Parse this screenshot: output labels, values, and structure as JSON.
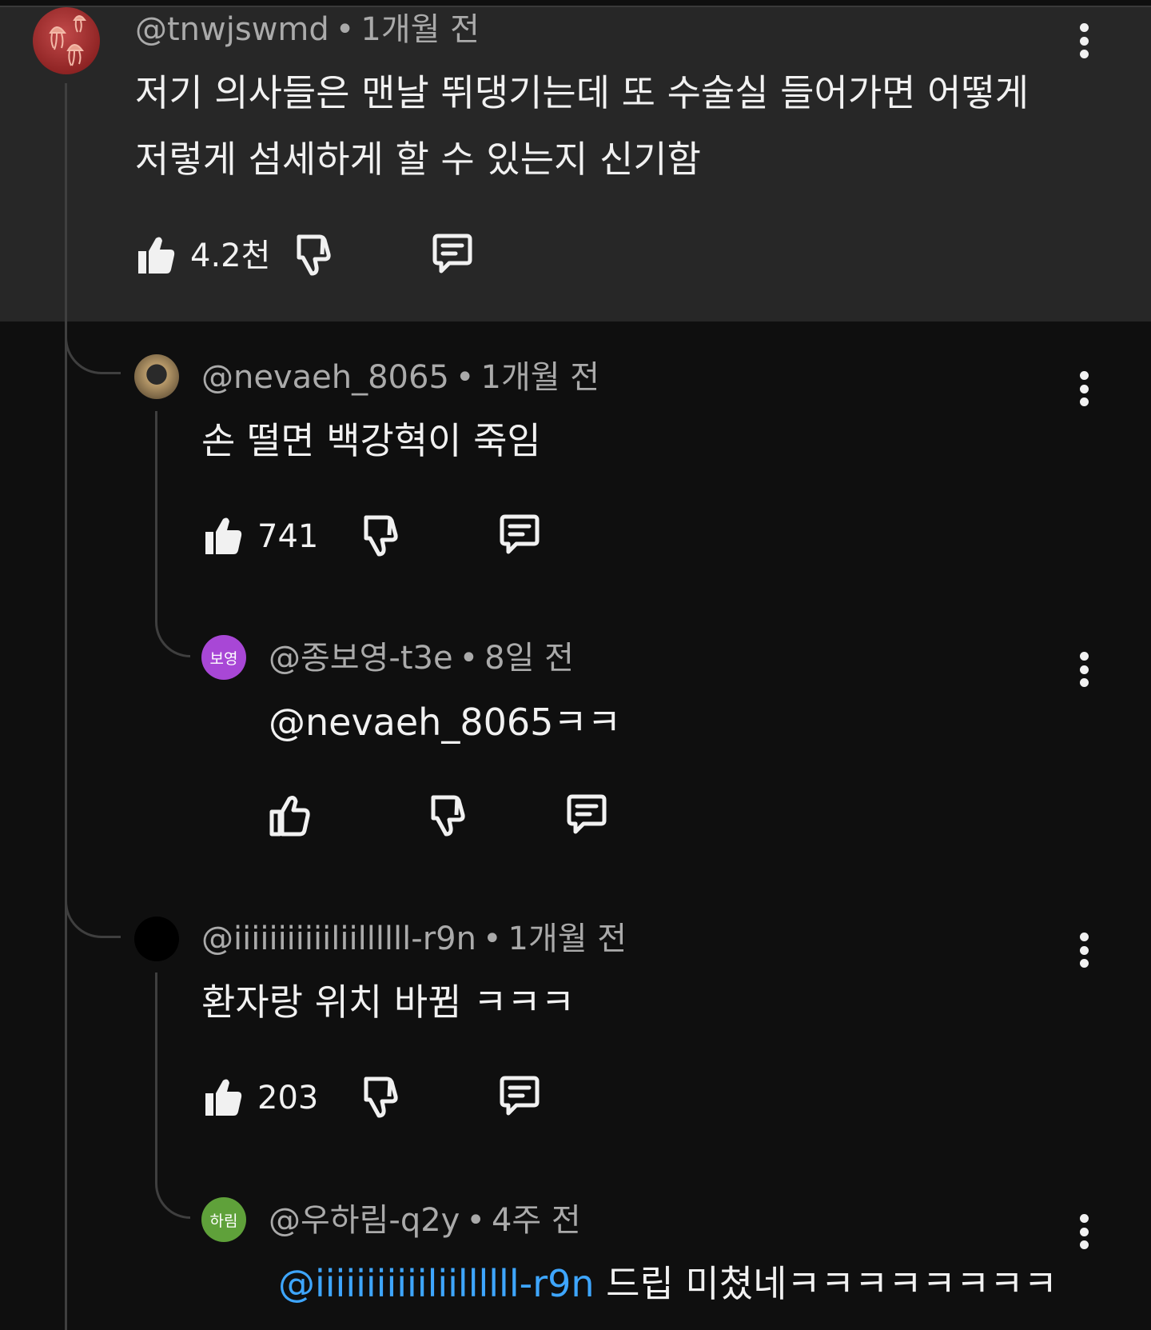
{
  "comments": [
    {
      "author": "@tnwjswmd",
      "time": "1개월 전",
      "text_line1": "저기 의사들은 맨날 뛰댕기는데 또 수술실 들어가면 어떻게",
      "text_line2": "저렇게 섬세하게 할 수 있는지 신기함",
      "likes": "4.2천",
      "liked": true
    },
    {
      "author": "@nevaeh_8065",
      "time": "1개월 전",
      "text": "손 떨면 백강혁이 죽임",
      "likes": "741",
      "liked": true
    },
    {
      "author": "@종보영-t3e",
      "avatar_text": "보영",
      "time": "8일 전",
      "text": "@nevaeh_8065ㅋㅋ",
      "likes": "",
      "liked": false
    },
    {
      "author": "@iiiiiiiiiiiliillllll-r9n",
      "time": "1개월 전",
      "text": "환자랑 위치 바뀜 ㅋㅋㅋ",
      "likes": "203",
      "liked": true
    },
    {
      "author": "@우하림-q2y",
      "avatar_text": "하림",
      "time": "4주 전",
      "mention": "@iiiiiiiiiiiliillllll-r9n",
      "text": " 드립 미쳤네ㅋㅋㅋㅋㅋㅋㅋㅋ"
    }
  ],
  "separator": "•",
  "colors": {
    "background": "#0f0f0f",
    "highlight": "#272727",
    "meta": "#aaaaaa",
    "mention": "#3ea6ff",
    "purple_avatar": "#a847d6",
    "green_avatar": "#5fa13a"
  },
  "icons": [
    "thumbs-up-icon",
    "thumbs-down-icon",
    "reply-icon",
    "more-vert-icon"
  ]
}
